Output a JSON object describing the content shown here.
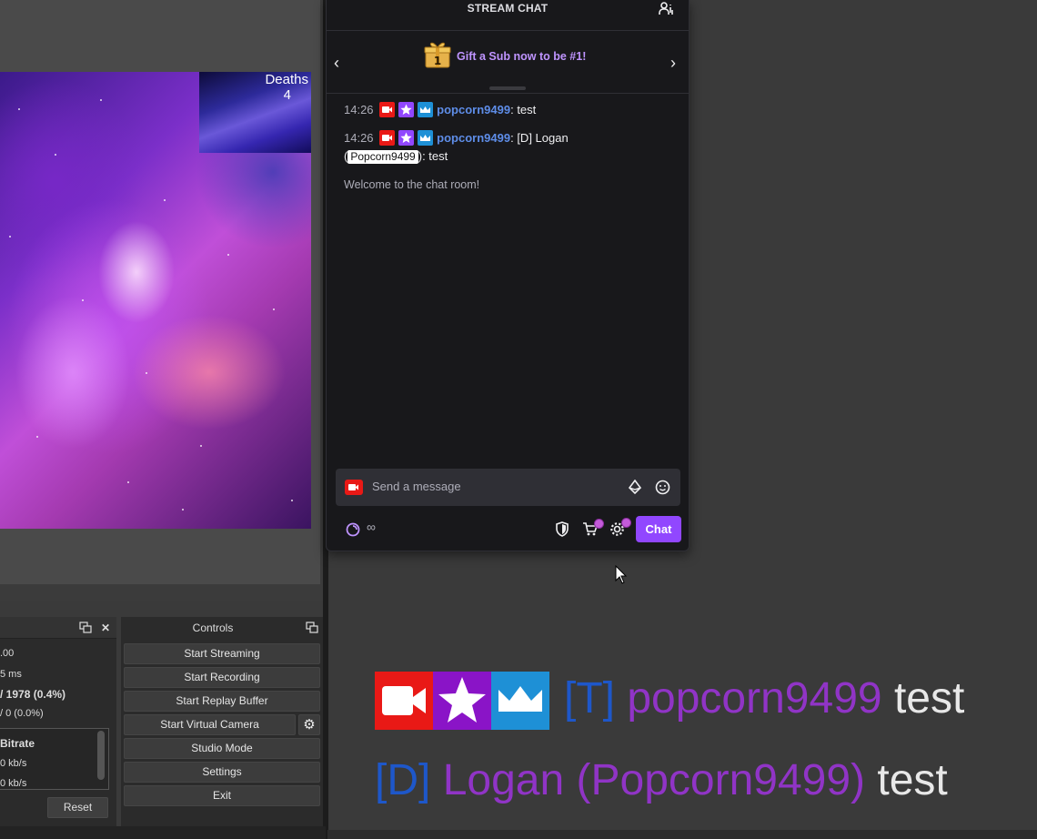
{
  "obs": {
    "deaths_label": "Deaths",
    "deaths_count": "4",
    "stats": {
      "line1": ".00",
      "line2": "5 ms",
      "line3": "/ 1978 (0.4%)",
      "line4": "/ 0 (0.0%)",
      "bitrate_header": "Bitrate",
      "bitrate1": "0 kb/s",
      "bitrate2": "0 kb/s",
      "reset_label": "Reset"
    },
    "controls": {
      "title": "Controls",
      "start_streaming": "Start Streaming",
      "start_recording": "Start Recording",
      "start_replay_buffer": "Start Replay Buffer",
      "start_virtual_camera": "Start Virtual Camera",
      "studio_mode": "Studio Mode",
      "settings": "Settings",
      "exit": "Exit"
    }
  },
  "chat": {
    "title": "STREAM CHAT",
    "gift_banner": "Gift a Sub now to be #1!",
    "gift_count": "1",
    "messages": [
      {
        "time": "14:26",
        "user": "popcorn9499",
        "text": ": test"
      },
      {
        "time": "14:26",
        "user": "popcorn9499",
        "text": ": [D] Logan",
        "line2_prefix": "(",
        "mention": "Popcorn9499",
        "line2_suffix": "): test"
      }
    ],
    "welcome": "Welcome to the chat room!",
    "input_placeholder": "Send a message",
    "points_value": "∞",
    "send_label": "Chat",
    "accent_color": "#9147ff"
  },
  "overlay": {
    "line1_tag": "[T]",
    "line1_user": "popcorn9499",
    "line1_msg": "test",
    "line2_tag": "[D]",
    "line2_user": "Logan (Popcorn9499)",
    "line2_msg": "test"
  }
}
